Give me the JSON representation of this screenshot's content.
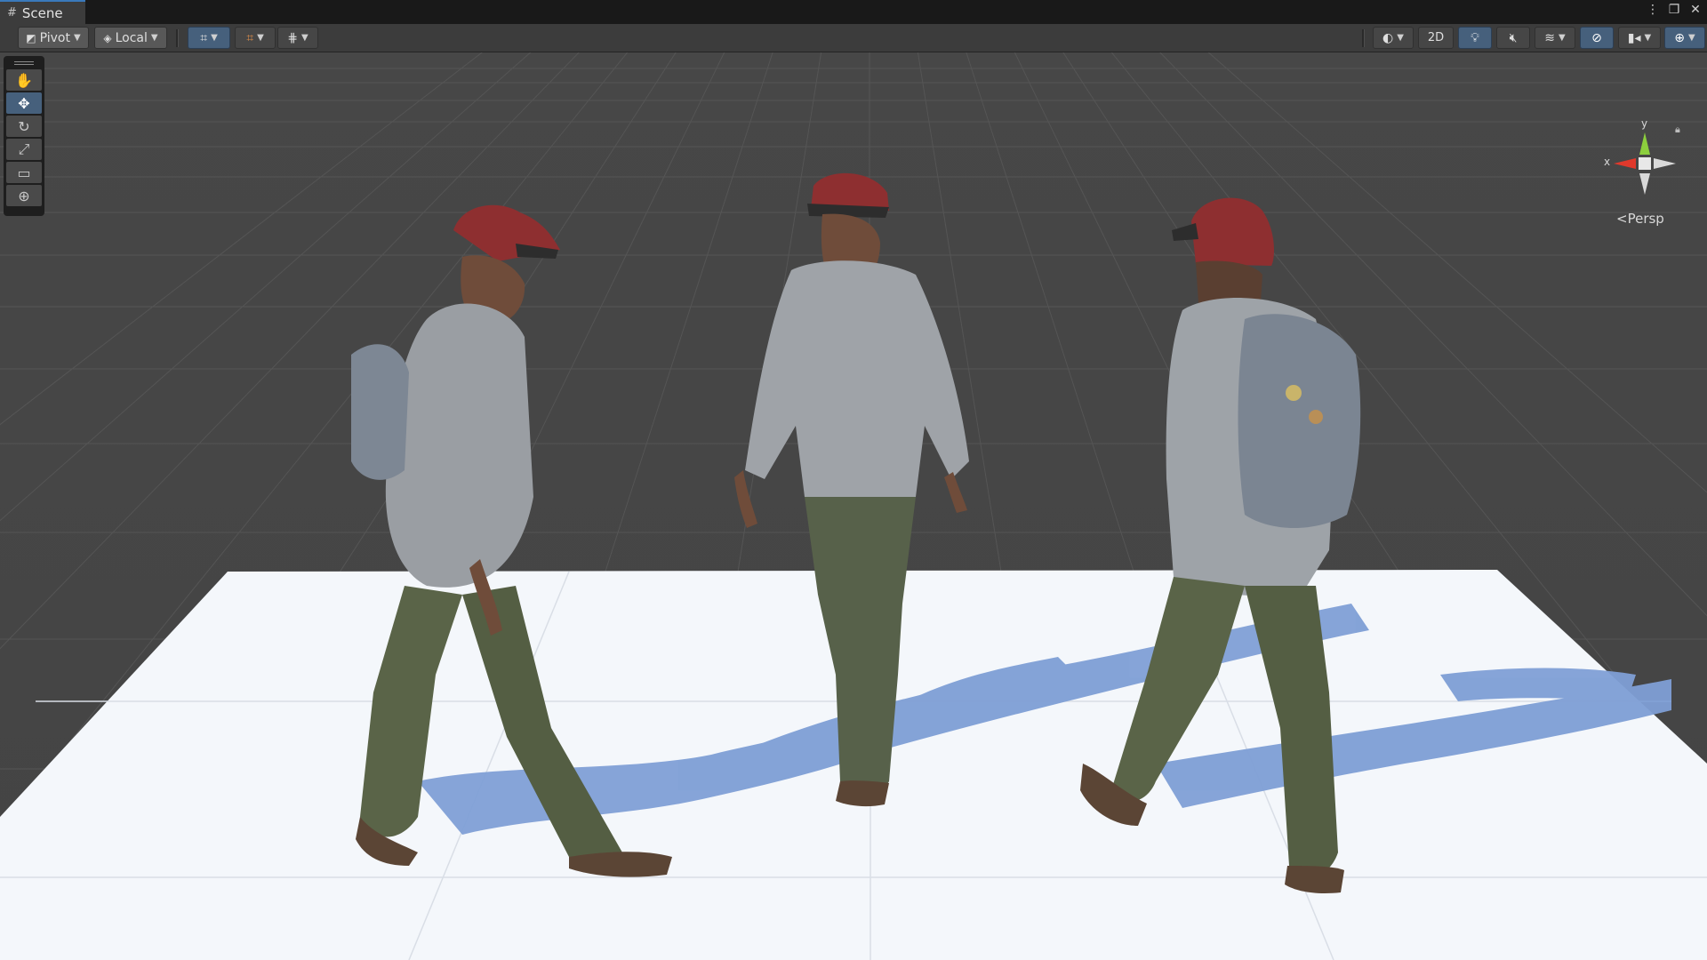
{
  "window": {
    "tab_title": "Scene",
    "tab_icon": "grid-icon",
    "controls": [
      "⋮",
      "❐",
      "✕"
    ]
  },
  "toolbar": {
    "pivot_label": "Pivot",
    "space_label": "Local",
    "two_d_label": "2D"
  },
  "tools": [
    {
      "name": "hand-tool",
      "glyph": "✋",
      "selected": false
    },
    {
      "name": "move-tool",
      "glyph": "✥",
      "selected": true
    },
    {
      "name": "rotate-tool",
      "glyph": "↻",
      "selected": false
    },
    {
      "name": "scale-tool",
      "glyph": "⤢",
      "selected": false
    },
    {
      "name": "rect-tool",
      "glyph": "▭",
      "selected": false
    },
    {
      "name": "transform-tool",
      "glyph": "⊕",
      "selected": false
    }
  ],
  "gizmo": {
    "y_label": "y",
    "x_label": "x",
    "projection_label": "Persp"
  },
  "colors": {
    "accent": "#3a79bb",
    "active_button": "#46607c",
    "gizmo_x": "#e0392c",
    "gizmo_y": "#8ccf3d",
    "floor": "#f4f7fb",
    "shadow": "#7f9fd6"
  },
  "scene": {
    "objects": [
      "character-side-view",
      "character-front-view",
      "character-back-view",
      "ground-plane"
    ]
  }
}
